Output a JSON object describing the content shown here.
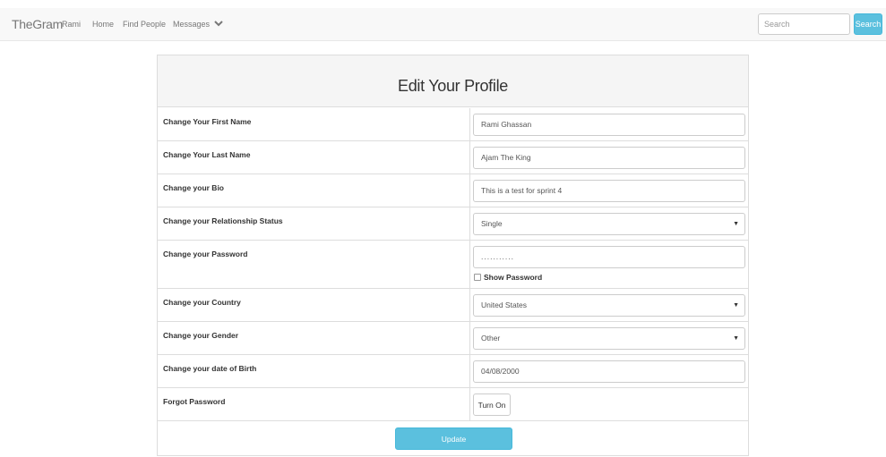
{
  "navbar": {
    "brand": "TheGram",
    "links": [
      "Rami",
      "Home",
      "Find People",
      "Messages"
    ],
    "dropdown_icon": "chevron-down-icon",
    "search_placeholder": "Search",
    "search_button": "Search",
    "accent_color": "#5bc0de"
  },
  "form": {
    "title": "Edit Your Profile",
    "rows": [
      {
        "label": "Change Your First Name",
        "value": "Rami Ghassan",
        "kind": "text"
      },
      {
        "label": "Change Your Last Name",
        "value": "Ajam The King",
        "kind": "text"
      },
      {
        "label": "Change your Bio",
        "value": "This is a test for sprint 4",
        "kind": "text"
      },
      {
        "label": "Change your Relationship Status",
        "value": "Single",
        "kind": "select"
      },
      {
        "label": "Change your Password",
        "value": "...........",
        "kind": "password",
        "show_password_label": "Show Password",
        "show_password_checked": false
      },
      {
        "label": "Change your Country",
        "value": "United States",
        "kind": "select"
      },
      {
        "label": "Change your Gender",
        "value": "Other",
        "kind": "select"
      },
      {
        "label": "Change your date of Birth",
        "value": "04/08/2000",
        "kind": "date"
      },
      {
        "label": "Forgot Password",
        "button": "Turn On",
        "kind": "button"
      }
    ],
    "submit": "Update"
  }
}
